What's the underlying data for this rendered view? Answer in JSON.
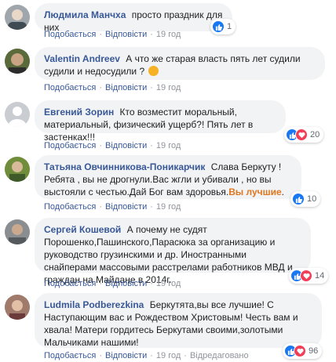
{
  "actions": {
    "like": "Подобається",
    "reply": "Відповісти"
  },
  "comments": [
    {
      "author": "Людмила Манчха",
      "text": "просто праздник для них",
      "time": "19 год",
      "count": "1"
    },
    {
      "author": "Valentin Andreev",
      "text": "А что же старая власть пять лет судили судили и недосудили ?",
      "time": "19 год"
    },
    {
      "author": "Евгений Зорин",
      "text": "Кто возместит моральный, материальный, физический ущерб?! Пять лет в застенках!!!",
      "time": "19 год",
      "count": "20"
    },
    {
      "author": "Татьяна Овчинникова-Поникарчик",
      "text": "Слава Беркуту ! Ребята , вы не дрогнули.Вас жгли и убивали , но вы выстояли с честью.Дай Бог вам здоровья.",
      "highlight": "Вы лучшие",
      "text_end": ".",
      "time": "19 год",
      "count": "10"
    },
    {
      "author": "Сергей Кошевой",
      "text": "А почему не судят Порошенко,Пашинского,Парасюка за организацию и руководство грузинскими и др. Иностранными снайперами массовыми расстрелами работников МВД и граждан на Майдане в 2014г.",
      "time": "19 год",
      "count": "14"
    },
    {
      "author": "Ludmila Podberezkina",
      "text": "Беркутята,вы все лучшие! С Наступающим вас и Рождеством Христовым! Честь вам и хвала! Матери гордитесь Беркутами своими,золотыми Мальчиками нашими!",
      "time": "19 год",
      "count": "96",
      "reply_label": "Відредаговано"
    }
  ]
}
